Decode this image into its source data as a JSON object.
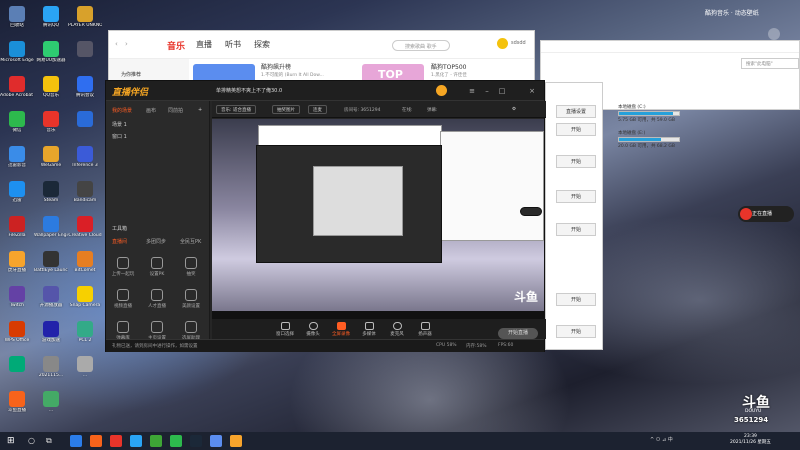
{
  "desktop": {
    "icons": [
      {
        "label": "回收站",
        "color": "#5b7fb5"
      },
      {
        "label": "腾讯QQ",
        "color": "#2aa4f4"
      },
      {
        "label": "PLAYER UNKNOWN'S BATTLEG...",
        "color": "#d8a12b"
      },
      {
        "label": "Microsoft Edge",
        "color": "#1a8fd8"
      },
      {
        "label": "网易UU加速器",
        "color": "#2ecc71"
      },
      {
        "label": "",
        "color": "#556"
      },
      {
        "label": "Adobe Acrobat DC",
        "color": "#e02c2c"
      },
      {
        "label": "QQ音乐",
        "color": "#f4c20d"
      },
      {
        "label": "腾讯会议",
        "color": "#2f6ef0"
      },
      {
        "label": "微信",
        "color": "#2db94d"
      },
      {
        "label": "音乐",
        "color": "#e8342a"
      },
      {
        "label": "",
        "color": "#2a6bd8"
      },
      {
        "label": "迅雷影音",
        "color": "#3a8ce8"
      },
      {
        "label": "WeGame",
        "color": "#e8a52b"
      },
      {
        "label": "Inference 3",
        "color": "#3b5bd8"
      },
      {
        "label": "迅雷",
        "color": "#1d90f0"
      },
      {
        "label": "Steam",
        "color": "#1b2838"
      },
      {
        "label": "Bandicam",
        "color": "#444"
      },
      {
        "label": "FileZilla",
        "color": "#c22"
      },
      {
        "label": "Wallpaper Engine",
        "color": "#2c7be0"
      },
      {
        "label": "Creative Cloud",
        "color": "#da1f26"
      },
      {
        "label": "虎牙直播",
        "color": "#f7a42c"
      },
      {
        "label": "BattlEye Launcher",
        "color": "#333"
      },
      {
        "label": "BitComet",
        "color": "#e67e22"
      },
      {
        "label": "Twitch",
        "color": "#6441a5"
      },
      {
        "label": "开源播放器",
        "color": "#55a"
      },
      {
        "label": "Snap Camera",
        "color": "#f7d000"
      },
      {
        "label": "WPS Office",
        "color": "#d83b01"
      },
      {
        "label": "游戏加速",
        "color": "#22a"
      },
      {
        "label": "PCL 2",
        "color": "#3a8"
      },
      {
        "label": "",
        "color": "#0a7"
      },
      {
        "label": "2021115...",
        "color": "#888"
      },
      {
        "label": "...",
        "color": "#aaa"
      },
      {
        "label": "斗鱼直播",
        "color": "#f7631b"
      },
      {
        "label": "...",
        "color": "#4a6"
      }
    ]
  },
  "music": {
    "nav": [
      "音乐",
      "直播",
      "听书",
      "探索"
    ],
    "search_placeholder": "搜索歌曲 歌手",
    "user": "sdsdd",
    "sidebar_item": "为你推荐",
    "cards": [
      {
        "title": "酷狗飙升榜",
        "sub": "1.不可能的 (Burn It All Dow...",
        "color": "#5b8def"
      },
      {
        "title": "TOP",
        "sub": "",
        "color": "#e7a6d8"
      },
      {
        "title": "酷狗TOP500",
        "sub": "1.黑化了 - 许佳佳",
        "color": "#ffffff"
      }
    ]
  },
  "topright": {
    "label": "酷狗音乐 · 动态壁纸"
  },
  "explorer": {
    "search": "搜索\"此电脑\"",
    "drives": [
      {
        "name": "本地磁盘 (C:)",
        "free": "5.75 GB 可用，共 59.0 GB",
        "used": 0.9
      },
      {
        "name": "本地磁盘 (E:)",
        "free": "20.0 GB 可用，共 68.2 GB",
        "used": 0.7
      }
    ]
  },
  "douyu": {
    "logo_main": "直播伴侣",
    "logo_brand": "斗鱼",
    "title": "单排精英想不爽上不了俺30.0",
    "title_tag": "直播中",
    "tabs": [
      "我的场景",
      "画布",
      "同前拍"
    ],
    "scenes": [
      "场景 1",
      "窗口 1"
    ],
    "tools_title": "工具箱",
    "tool_tabs": [
      "直播间",
      "多团同步",
      "全民互PK"
    ],
    "tools": [
      "上传一起玩",
      "设置PK",
      "抽奖"
    ],
    "tools2": [
      "视频直播",
      "人才直播",
      "美颜设置"
    ],
    "tools3": [
      "弹幕库",
      "主页设置",
      "选屏助理"
    ],
    "chips": [
      "音乐: 适合直播",
      "抽奖图片",
      "连麦",
      "直播设置"
    ],
    "stats": [
      "房间号: 3651294",
      "在线:",
      "弹幕:"
    ],
    "bottom": [
      "窗口选择",
      "摄像头",
      "全屏录像",
      "多媒体",
      "麦克风",
      "扬声器"
    ],
    "active_bottom": 2,
    "live_button": "开始直播",
    "status": [
      "礼物已送，请到房间中进行操作，如需设置",
      "CPU 58%",
      "内存:58%",
      "直播分辨率",
      "FPS:60"
    ]
  },
  "side_panel": {
    "buttons": [
      "直播设置",
      "开始",
      "开始",
      "开始",
      "开始",
      "开始",
      "开始"
    ]
  },
  "badge": {
    "label": "正在直播"
  },
  "watermark": {
    "logo": "斗鱼",
    "sub": "DOUYU",
    "room": "3651294"
  },
  "taskbar": {
    "start": "⊞",
    "icons": [
      "#2b7de9",
      "#f7631b",
      "#e8342a",
      "#2aa4f4",
      "#3ea636",
      "#2db94d",
      "#1b2838",
      "#5b8def",
      "#f7a42c"
    ],
    "tray": "^  ㅁ  ⊿ 中",
    "time": "23:39",
    "date": "2021/11/26 星期五"
  }
}
